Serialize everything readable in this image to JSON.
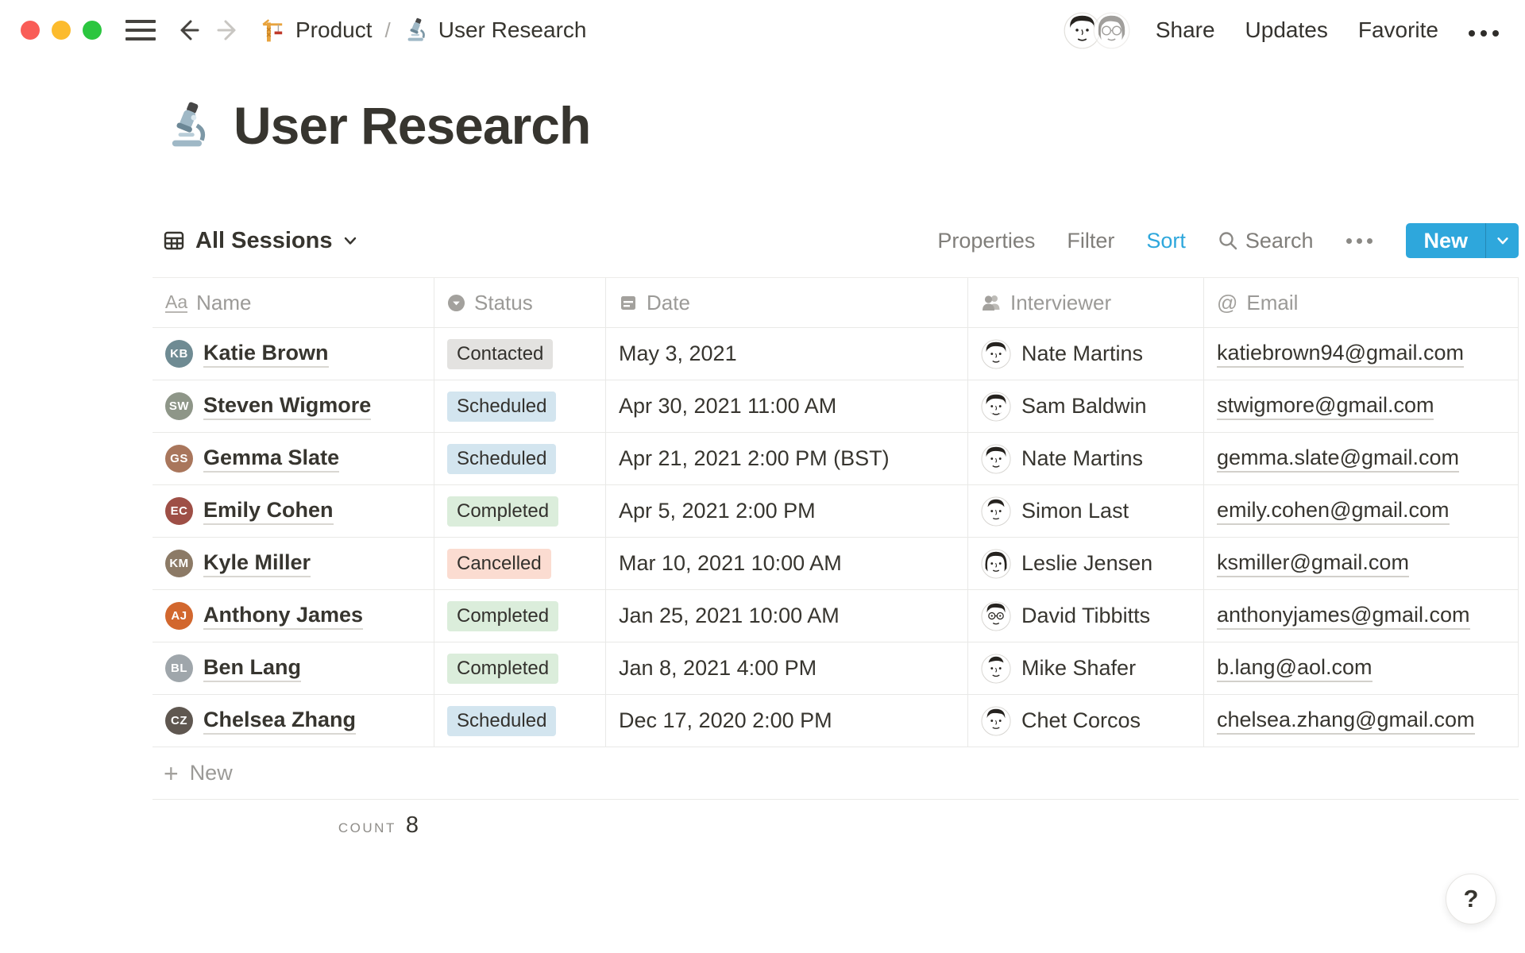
{
  "colors": {
    "accent_blue": "#2EA7DC",
    "text_dark": "#37352F",
    "text_gray": "#9B9A97",
    "status_gray_bg": "#E3E2E0",
    "status_blue_bg": "#D3E5EF",
    "status_green_bg": "#DBEDDB",
    "status_red_bg": "#FBDCD1",
    "traffic_red": "#F95D57",
    "traffic_yellow": "#FCBB2D",
    "traffic_green": "#2BC63F"
  },
  "topbar": {
    "breadcrumb": [
      {
        "icon": "crane-icon",
        "label": "Product"
      },
      {
        "icon": "microscope-icon",
        "label": "User Research"
      }
    ],
    "breadcrumb_separator": "/",
    "actions": {
      "share": "Share",
      "updates": "Updates",
      "favorite": "Favorite"
    }
  },
  "page": {
    "icon": "microscope-icon",
    "title": "User Research"
  },
  "viewbar": {
    "view_name": "All Sessions",
    "properties": "Properties",
    "filter": "Filter",
    "sort": "Sort",
    "search": "Search",
    "new_button": "New"
  },
  "table": {
    "columns": [
      {
        "label": "Name",
        "icon": "title-icon"
      },
      {
        "label": "Status",
        "icon": "select-icon"
      },
      {
        "label": "Date",
        "icon": "calendar-icon"
      },
      {
        "label": "Interviewer",
        "icon": "person-icon"
      },
      {
        "label": "Email",
        "icon": "at-icon",
        "at_glyph": "@"
      }
    ],
    "title_icon_glyph": "Aa",
    "rows": [
      {
        "name": "Katie Brown",
        "initials": "KB",
        "avatar_color": "#6F8B93",
        "status": "Contacted",
        "status_key": "gray",
        "date": "May 3, 2021",
        "interviewer": "Nate Martins",
        "email": "katiebrown94@gmail.com"
      },
      {
        "name": "Steven Wigmore",
        "initials": "SW",
        "avatar_color": "#8E9688",
        "status": "Scheduled",
        "status_key": "blue",
        "date": "Apr 30, 2021 11:00 AM",
        "interviewer": "Sam Baldwin",
        "email": "stwigmore@gmail.com"
      },
      {
        "name": "Gemma Slate",
        "initials": "GS",
        "avatar_color": "#A9765C",
        "status": "Scheduled",
        "status_key": "blue",
        "date": "Apr 21, 2021 2:00 PM (BST)",
        "interviewer": "Nate Martins",
        "email": "gemma.slate@gmail.com"
      },
      {
        "name": "Emily Cohen",
        "initials": "EC",
        "avatar_color": "#9E4F46",
        "status": "Completed",
        "status_key": "green",
        "date": "Apr 5, 2021 2:00 PM",
        "interviewer": "Simon Last",
        "email": "emily.cohen@gmail.com"
      },
      {
        "name": "Kyle Miller",
        "initials": "KM",
        "avatar_color": "#8C7A66",
        "status": "Cancelled",
        "status_key": "red",
        "date": "Mar 10, 2021 10:00 AM",
        "interviewer": "Leslie Jensen",
        "email": "ksmiller@gmail.com"
      },
      {
        "name": "Anthony James",
        "initials": "AJ",
        "avatar_color": "#D2672E",
        "status": "Completed",
        "status_key": "green",
        "date": "Jan 25, 2021 10:00 AM",
        "interviewer": "David Tibbitts",
        "email": "anthonyjames@gmail.com"
      },
      {
        "name": "Ben Lang",
        "initials": "BL",
        "avatar_color": "#9FA6AB",
        "status": "Completed",
        "status_key": "green",
        "date": "Jan 8, 2021 4:00 PM",
        "interviewer": "Mike Shafer",
        "email": "b.lang@aol.com"
      },
      {
        "name": "Chelsea Zhang",
        "initials": "CZ",
        "avatar_color": "#5F5750",
        "status": "Scheduled",
        "status_key": "blue",
        "date": "Dec 17, 2020 2:00 PM",
        "interviewer": "Chet Corcos",
        "email": "chelsea.zhang@gmail.com"
      }
    ],
    "new_row_label": "New",
    "count_label": "COUNT",
    "count_value": "8"
  },
  "help": {
    "label": "?"
  }
}
